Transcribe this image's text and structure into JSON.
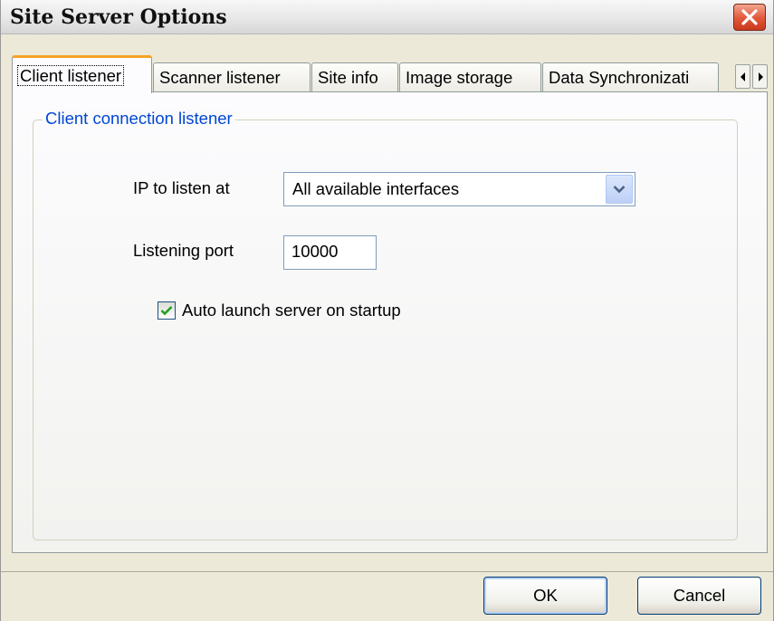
{
  "window": {
    "title": "Site Server Options"
  },
  "tabs": [
    {
      "label": "Client listener",
      "active": true
    },
    {
      "label": "Scanner listener",
      "active": false
    },
    {
      "label": "Site info",
      "active": false
    },
    {
      "label": "Image storage",
      "active": false
    },
    {
      "label": "Data Synchronizati",
      "active": false
    }
  ],
  "group": {
    "legend": "Client connection listener",
    "ip_label": "IP to listen at",
    "ip_value": "All available interfaces",
    "port_label": "Listening port",
    "port_value": "10000",
    "autolaunch_label": "Auto launch server on startup",
    "autolaunch_checked": true
  },
  "buttons": {
    "ok": "OK",
    "cancel": "Cancel"
  },
  "icons": {
    "close": "close-icon",
    "scroll_left": "arrow-left-icon",
    "scroll_right": "arrow-right-icon",
    "dropdown": "chevron-down-icon",
    "check": "check-icon"
  },
  "colors": {
    "legend_text": "#0046d5",
    "active_tab_accent": "#f7a324",
    "close_button": "#e2573a",
    "checkmark": "#21a121"
  }
}
